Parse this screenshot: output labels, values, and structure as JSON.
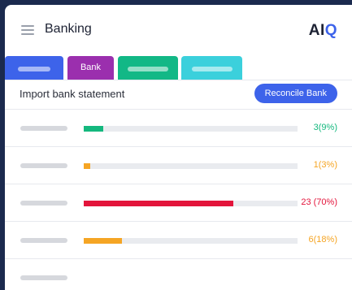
{
  "header": {
    "title": "Banking",
    "logo_prefix": "AI",
    "logo_accent": "Q",
    "logo_accent_color": "#3d63ea"
  },
  "tabs": [
    {
      "label": "",
      "color": "#3d63ea",
      "active": false
    },
    {
      "label": "Bank",
      "color": "#9b2fae",
      "active": true
    },
    {
      "label": "",
      "color": "#12b886",
      "active": false
    },
    {
      "label": "",
      "color": "#3bd0dc",
      "active": false
    }
  ],
  "toolbar": {
    "import_label": "Import bank statement",
    "reconcile_label": "Reconcile Bank"
  },
  "rows": [
    {
      "name": "",
      "percent": 9,
      "count_text": "3(9%)",
      "color": "#14b87e"
    },
    {
      "name": "",
      "percent": 3,
      "count_text": "1(3%)",
      "color": "#f5a524"
    },
    {
      "name": "",
      "percent": 70,
      "count_text": "23 (70%)",
      "color": "#e3143b"
    },
    {
      "name": "",
      "percent": 18,
      "count_text": "6(18%)",
      "color": "#f5a524"
    },
    {
      "name": "",
      "percent": null,
      "count_text": "",
      "color": "#d6d8dd"
    }
  ]
}
